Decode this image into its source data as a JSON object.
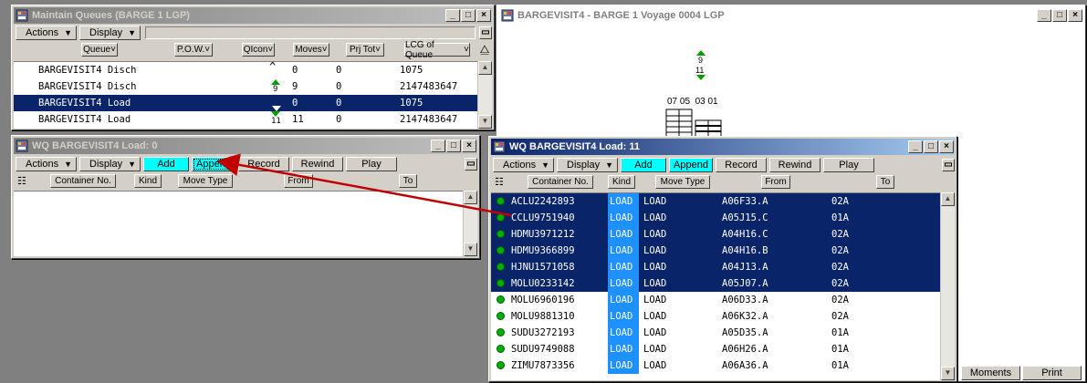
{
  "queues_window": {
    "title": "Maintain Queues (BARGE 1 LGP)",
    "menus": [
      "Actions",
      "Display"
    ],
    "columns": [
      "Queue",
      "P.O.W.",
      "QIcon",
      "Moves",
      "Prj Tot",
      "LCG of Queue"
    ],
    "rows": [
      {
        "queue": "BARGEVISIT4 Disch",
        "icon_num": "",
        "moves": "0",
        "prj": "0",
        "lcg": "1075"
      },
      {
        "queue": "BARGEVISIT4 Disch",
        "icon_num": "9",
        "moves": "9",
        "prj": "0",
        "lcg": "2147483647"
      },
      {
        "queue": "BARGEVISIT4 Load",
        "icon_num": "",
        "moves": "0",
        "prj": "0",
        "lcg": "1075"
      },
      {
        "queue": "BARGEVISIT4 Load",
        "icon_num": "11",
        "moves": "11",
        "prj": "0",
        "lcg": "2147483647"
      }
    ]
  },
  "barge_window": {
    "title": "BARGEVISIT4 - BARGE 1  Voyage 0004 LGP",
    "count_top": "9",
    "count_bottom": "11",
    "bay_labels": "07 05  03 01",
    "moments_label": "Moments",
    "print_label": "Print"
  },
  "wq_empty": {
    "title": "WQ BARGEVISIT4 Load:  0",
    "menus": [
      "Actions",
      "Display"
    ],
    "buttons": [
      "Add",
      "Append",
      "Record",
      "Rewind",
      "Play"
    ],
    "columns": [
      "Container No.",
      "Kind",
      "Move Type",
      "From",
      "To"
    ]
  },
  "wq_full": {
    "title": "WQ BARGEVISIT4 Load:  11",
    "menus": [
      "Actions",
      "Display"
    ],
    "buttons": [
      "Add",
      "Append",
      "Record",
      "Rewind",
      "Play"
    ],
    "columns": [
      "Container No.",
      "Kind",
      "Move Type",
      "From",
      "To"
    ],
    "rows": [
      {
        "container": "ACLU2242893",
        "kind": "LOAD",
        "move": "LOAD",
        "from": "A06F33.A",
        "to": "02A",
        "selected": true
      },
      {
        "container": "CCLU9751940",
        "kind": "LOAD",
        "move": "LOAD",
        "from": "A05J15.C",
        "to": "01A",
        "selected": true
      },
      {
        "container": "HDMU3971212",
        "kind": "LOAD",
        "move": "LOAD",
        "from": "A04H16.C",
        "to": "02A",
        "selected": true
      },
      {
        "container": "HDMU9366899",
        "kind": "LOAD",
        "move": "LOAD",
        "from": "A04H16.B",
        "to": "02A",
        "selected": true
      },
      {
        "container": "HJNU1571058",
        "kind": "LOAD",
        "move": "LOAD",
        "from": "A04J13.A",
        "to": "02A",
        "selected": true
      },
      {
        "container": "MOLU0233142",
        "kind": "LOAD",
        "move": "LOAD",
        "from": "A05J07.A",
        "to": "02A",
        "selected": true
      },
      {
        "container": "MOLU6960196",
        "kind": "LOAD",
        "move": "LOAD",
        "from": "A06D33.A",
        "to": "02A",
        "selected": false
      },
      {
        "container": "MOLU9881310",
        "kind": "LOAD",
        "move": "LOAD",
        "from": "A06K32.A",
        "to": "02A",
        "selected": false
      },
      {
        "container": "SUDU3272193",
        "kind": "LOAD",
        "move": "LOAD",
        "from": "A05D35.A",
        "to": "01A",
        "selected": false
      },
      {
        "container": "SUDU9749088",
        "kind": "LOAD",
        "move": "LOAD",
        "from": "A06H26.A",
        "to": "01A",
        "selected": false
      },
      {
        "container": "ZIMU7873356",
        "kind": "LOAD",
        "move": "LOAD",
        "from": "A06A36.A",
        "to": "01A",
        "selected": false
      }
    ]
  },
  "colors": {
    "selection": "#0a246a",
    "cyan_button": "#00ffff",
    "kind_highlight": "#1e90ff",
    "arrow": "#c00000",
    "status_dot": "#00b000"
  }
}
